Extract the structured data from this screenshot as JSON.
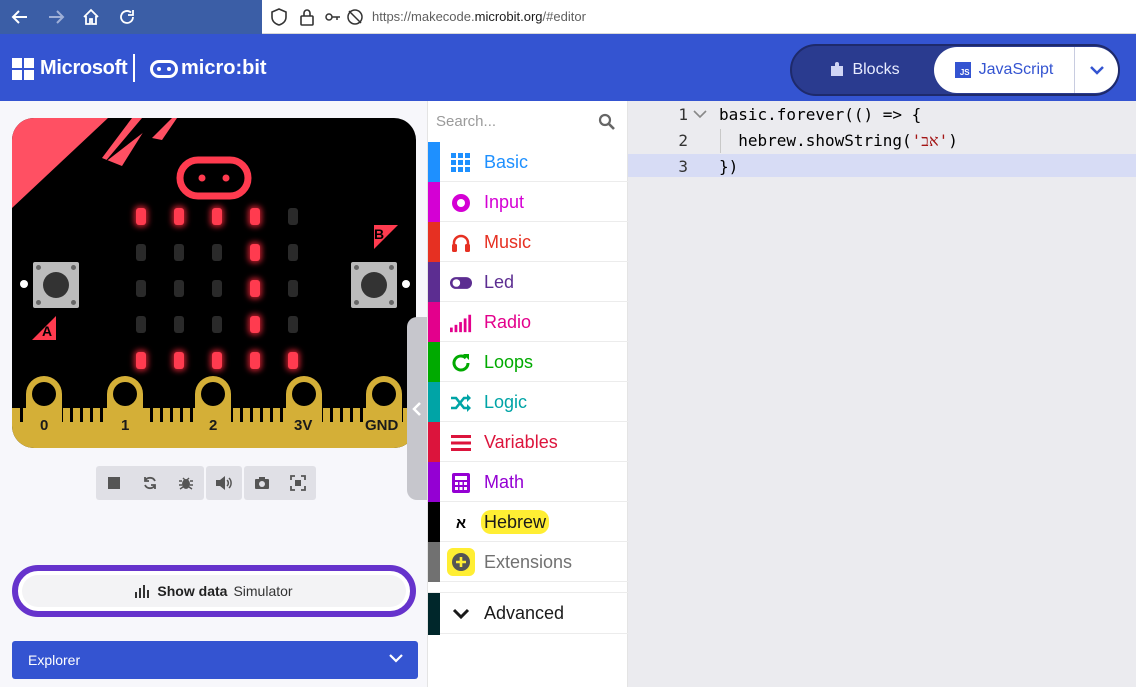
{
  "browser": {
    "url_prefix": "https://makecode.",
    "url_domain": "microbit.org",
    "url_suffix": "/#editor"
  },
  "header": {
    "brand": "Microsoft",
    "product": "micro:bit",
    "blocks_label": "Blocks",
    "js_label": "JavaScript",
    "js_badge": "JS",
    "colors": {
      "header": "#3454d1",
      "toggle": "#2a3b8f"
    }
  },
  "simulator": {
    "led_grid": [
      [
        1,
        1,
        1,
        1,
        0
      ],
      [
        0,
        0,
        0,
        1,
        0
      ],
      [
        0,
        0,
        0,
        1,
        0
      ],
      [
        0,
        0,
        0,
        1,
        0
      ],
      [
        1,
        1,
        1,
        1,
        1
      ]
    ],
    "pins": [
      "0",
      "1",
      "2",
      "3V",
      "GND"
    ],
    "button_a": "A",
    "button_b": "B",
    "toolbar_icons": [
      "stop-icon",
      "restart-icon",
      "debug-icon",
      "sound-icon",
      "screenshot-icon",
      "fullscreen-icon"
    ],
    "show_data_bold": "Show data",
    "show_data_rest": "Simulator",
    "explorer_label": "Explorer"
  },
  "toolbox": {
    "search_placeholder": "Search...",
    "categories": [
      {
        "label": "Basic",
        "color": "#1e90ff",
        "icon": "grid-icon"
      },
      {
        "label": "Input",
        "color": "#d400d4",
        "icon": "target-icon"
      },
      {
        "label": "Music",
        "color": "#e63022",
        "icon": "headphones-icon"
      },
      {
        "label": "Led",
        "color": "#5c2d91",
        "icon": "toggle-icon"
      },
      {
        "label": "Radio",
        "color": "#e3008c",
        "icon": "signal-icon"
      },
      {
        "label": "Loops",
        "color": "#00aa00",
        "icon": "refresh-icon"
      },
      {
        "label": "Logic",
        "color": "#00a4a6",
        "icon": "shuffle-icon"
      },
      {
        "label": "Variables",
        "color": "#dc143c",
        "icon": "lines-icon"
      },
      {
        "label": "Math",
        "color": "#9400d3",
        "icon": "calculator-icon"
      },
      {
        "label": "Hebrew",
        "color": "#000000",
        "icon": "aleph-icon"
      },
      {
        "label": "Extensions",
        "color": "#717171",
        "icon": "plus-circle-icon"
      }
    ],
    "advanced_label": "Advanced",
    "aleph": "א"
  },
  "editor": {
    "line_numbers": [
      "1",
      "2",
      "3"
    ],
    "line1": "basic.forever(() => {",
    "line2_pre": "  hebrew.showString(",
    "line2_str": "'אב'",
    "line2_post": ")",
    "line3": "})"
  }
}
